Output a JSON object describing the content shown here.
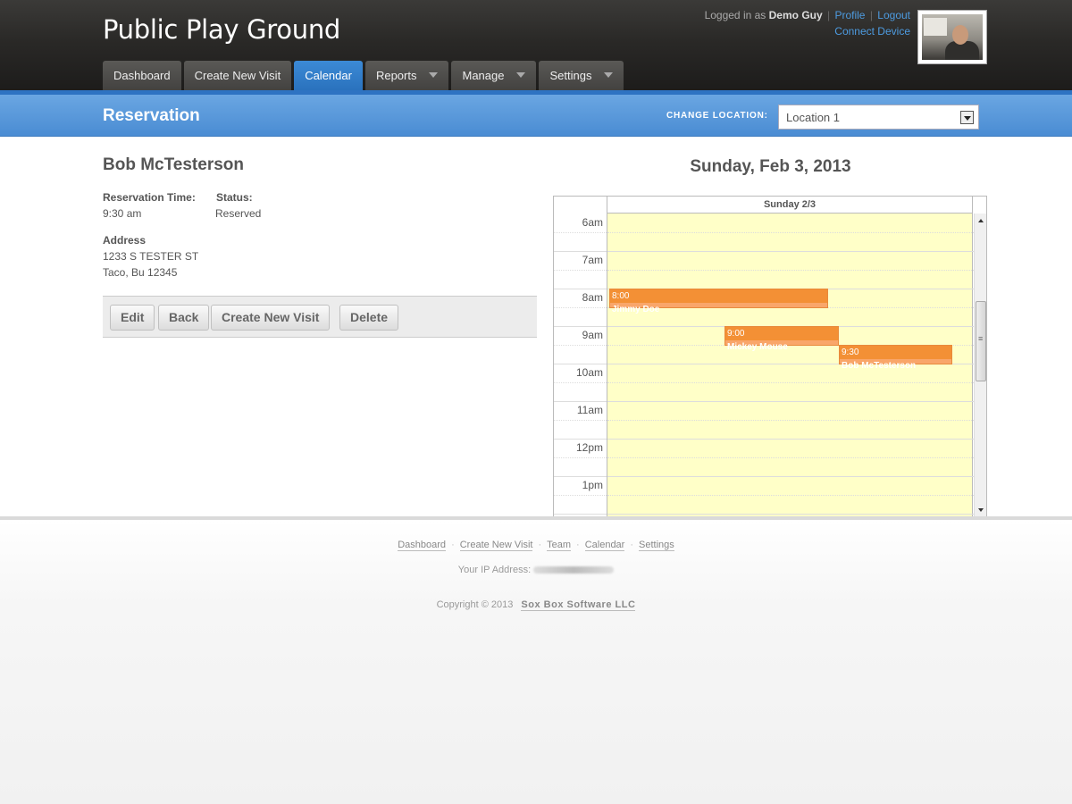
{
  "app": {
    "title": "Public Play Ground"
  },
  "user": {
    "prefix": "Logged in as",
    "name": "Demo Guy",
    "profile": "Profile",
    "logout": "Logout",
    "connect": "Connect Device",
    "sep": "|"
  },
  "nav": {
    "tabs": [
      {
        "label": "Dashboard",
        "active": false,
        "dropdown": false
      },
      {
        "label": "Create New Visit",
        "active": false,
        "dropdown": false
      },
      {
        "label": "Calendar",
        "active": true,
        "dropdown": false
      },
      {
        "label": "Reports",
        "active": false,
        "dropdown": true
      },
      {
        "label": "Manage",
        "active": false,
        "dropdown": true
      },
      {
        "label": "Settings",
        "active": false,
        "dropdown": true
      }
    ]
  },
  "bar": {
    "title": "Reservation",
    "location_label": "CHANGE LOCATION:",
    "location_value": "Location 1"
  },
  "reservation": {
    "name": "Bob McTesterson",
    "time_label": "Reservation Time:",
    "time_value": "9:30 am",
    "status_label": "Status:",
    "status_value": "Reserved",
    "address_label": "Address",
    "address_line1": "1233 S TESTER ST",
    "address_line2": "Taco, Bu 12345"
  },
  "actions": {
    "edit": "Edit",
    "back": "Back",
    "create": "Create New Visit",
    "delete": "Delete"
  },
  "calendar": {
    "date_title": "Sunday, Feb 3, 2013",
    "day_header": "Sunday 2/3",
    "hours": [
      "6am",
      "7am",
      "8am",
      "9am",
      "10am",
      "11am",
      "12pm",
      "1pm"
    ],
    "events": [
      {
        "time": "8:00",
        "name": "Jimmy Doe",
        "start_hour": 8.0,
        "end_hour": 8.75,
        "column": 0
      },
      {
        "time": "9:00",
        "name": "Mickey Mouse",
        "start_hour": 9.0,
        "end_hour": 9.75,
        "column": 1
      },
      {
        "time": "9:30",
        "name": "Bob McTesterson",
        "start_hour": 9.5,
        "end_hour": 10.25,
        "column": 2
      }
    ]
  },
  "footer": {
    "links": [
      "Dashboard",
      "Create New Visit",
      "Team",
      "Calendar",
      "Settings"
    ],
    "ip_label": "Your IP Address:",
    "copyright": "Copyright © 2013",
    "company": "Sox Box Software LLC"
  },
  "colors": {
    "header": "#2a2927",
    "active_tab": "#2a72bd",
    "bar": "#5a98da",
    "event": "#f39035",
    "calendar_day": "#ffffc8"
  }
}
